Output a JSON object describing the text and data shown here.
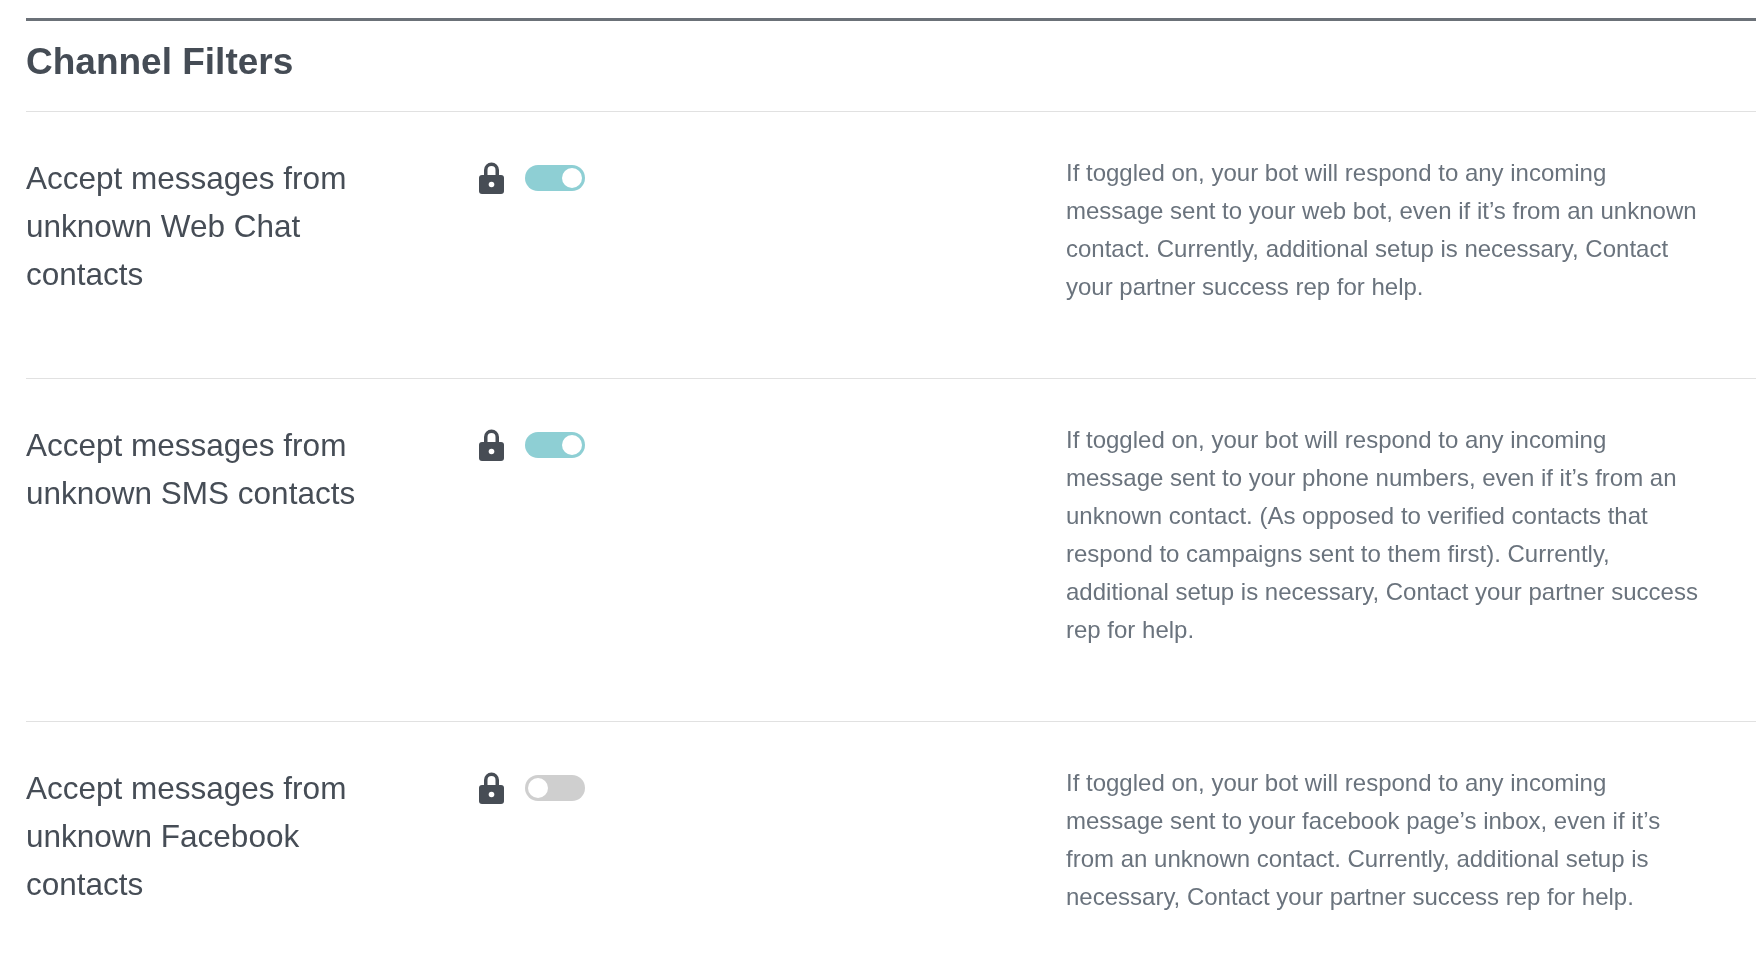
{
  "title": "Channel Filters",
  "filters": [
    {
      "label": "Accept messages from unknown Web Chat contacts",
      "locked": true,
      "on": true,
      "description": "If toggled on, your bot will respond to any incoming message sent to your web bot, even if it’s from an unknown contact. Currently, additional setup is necessary, Contact your partner success rep for help."
    },
    {
      "label": "Accept messages from unknown SMS contacts",
      "locked": true,
      "on": true,
      "description": "If toggled on, your bot will respond to any incoming message sent to your phone numbers, even if it’s from an unknown contact. (As opposed to verified contacts that respond to campaigns sent to them first). Currently, additional setup is necessary, Contact your partner success rep for help."
    },
    {
      "label": "Accept messages from unknown Facebook contacts",
      "locked": true,
      "on": false,
      "description": "If toggled on, your bot will respond to any incoming message sent to your facebook page’s inbox, even if it’s from an unknown contact. Currently, additional setup is necessary, Contact your partner success rep for help."
    }
  ]
}
